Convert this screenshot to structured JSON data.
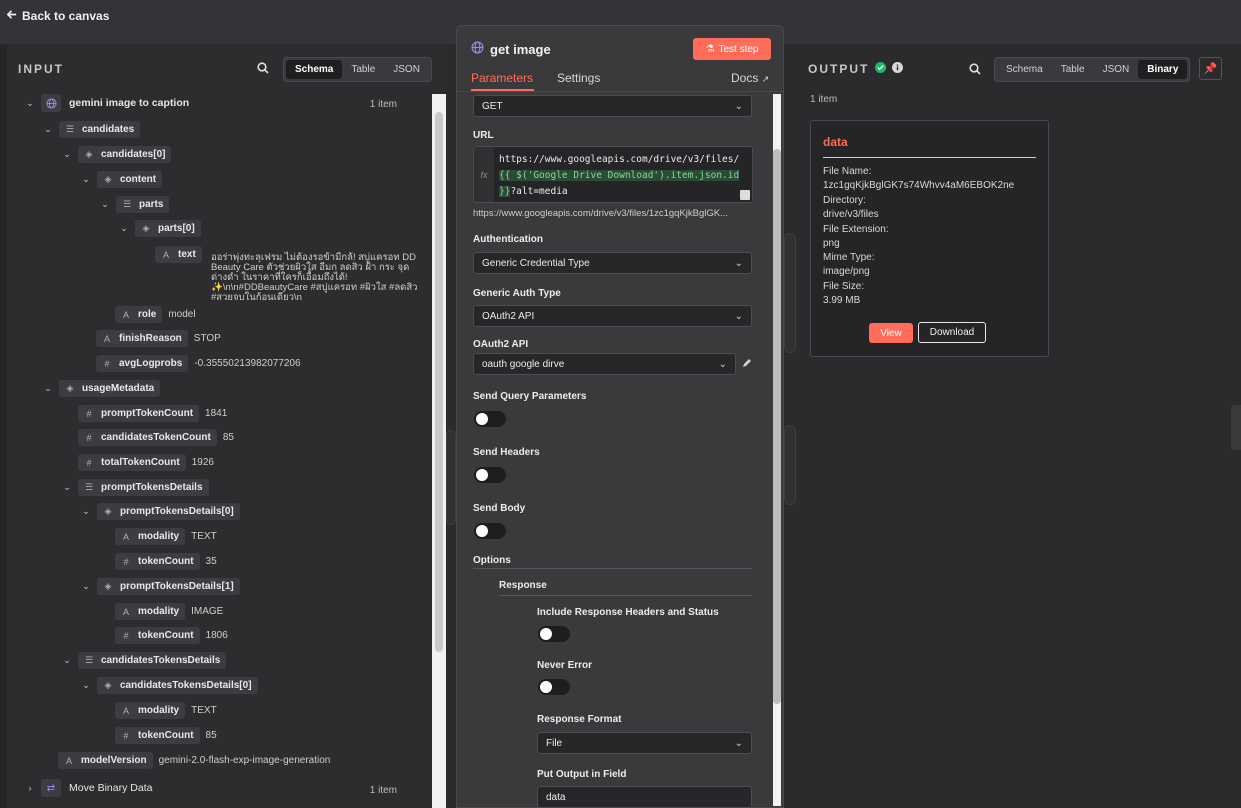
{
  "topbar": {
    "back_label": "Back to canvas"
  },
  "input": {
    "title": "INPUT",
    "tabs": [
      "Schema",
      "Table",
      "JSON"
    ],
    "active_tab": "Schema",
    "root_label": "gemini image to caption",
    "root_count": "1 item",
    "bottom_label": "Move Binary Data",
    "bottom_count": "1 item",
    "tree": {
      "candidates": "candidates",
      "candidates0": "candidates[0]",
      "content": "content",
      "parts": "parts",
      "parts0": "parts[0]",
      "text_key": "text",
      "text_value": "ออร่าพุ่งทะลุเฟรม ไม่ต้องรอข้ามีกล้! สบู่แครอท DD Beauty Care ตัวช่วยผิวใส อีมก ลดสิว ฝ้า กระ จุดด่างดำ ในราคาที่ใครก็เอื้อมถึงได้! ✨\\n\\n#DDBeautyCare #สบู่แครอท #ผิวใส #ลดสิว #สวยจบในก้อนเดียว\\n",
      "role_key": "role",
      "role_value": "model",
      "finish_key": "finishReason",
      "finish_value": "STOP",
      "avglog_key": "avgLogprobs",
      "avglog_value": "-0.35550213982077206",
      "usage": "usageMetadata",
      "prompt_count_key": "promptTokenCount",
      "prompt_count_value": "1841",
      "cand_count_key": "candidatesTokenCount",
      "cand_count_value": "85",
      "total_key": "totalTokenCount",
      "total_value": "1926",
      "ptd": "promptTokensDetails",
      "ptd0": "promptTokensDetails[0]",
      "modality_key": "modality",
      "ptd0_modality": "TEXT",
      "tokencount_key": "tokenCount",
      "ptd0_count": "35",
      "ptd1": "promptTokensDetails[1]",
      "ptd1_modality": "IMAGE",
      "ptd1_count": "1806",
      "ctd": "candidatesTokensDetails",
      "ctd0": "candidatesTokensDetails[0]",
      "ctd0_modality": "TEXT",
      "ctd0_count": "85",
      "mv_key": "modelVersion",
      "mv_value": "gemini-2.0-flash-exp-image-generation"
    }
  },
  "node": {
    "title": "get image",
    "test_label": "Test step",
    "tabs": {
      "parameters": "Parameters",
      "settings": "Settings",
      "docs": "Docs"
    },
    "method": "GET",
    "url_label": "URL",
    "url_part1": "https://www.googleapis.com/drive/v3/files/",
    "url_expr": "{{ $('Google Drive Download').item.json.id }}",
    "url_part2": "?alt=media",
    "url_preview": "https://www.googleapis.com/drive/v3/files/1zc1gqKjkBglGK...",
    "auth_label": "Authentication",
    "auth_value": "Generic Credential Type",
    "gat_label": "Generic Auth Type",
    "gat_value": "OAuth2 API",
    "oauth_label": "OAuth2 API",
    "oauth_value": "oauth google dirve",
    "sqp_label": "Send Query Parameters",
    "sh_label": "Send Headers",
    "sb_label": "Send Body",
    "options_label": "Options",
    "response_label": "Response",
    "irh_label": "Include Response Headers and Status",
    "ne_label": "Never Error",
    "rf_label": "Response Format",
    "rf_value": "File",
    "pof_label": "Put Output in Field",
    "pof_value": "data"
  },
  "output": {
    "title": "OUTPUT",
    "tabs": [
      "Schema",
      "Table",
      "JSON",
      "Binary"
    ],
    "active_tab": "Binary",
    "count": "1 item",
    "card": {
      "title": "data",
      "file_name_label": "File Name:",
      "file_name": "1zc1gqKjkBglGK7s74Whvv4aM6EBOK2ne",
      "directory_label": "Directory:",
      "directory": "drive/v3/files",
      "ext_label": "File Extension:",
      "ext": "png",
      "mime_label": "Mime Type:",
      "mime": "image/png",
      "size_label": "File Size:",
      "size": "3.99 MB",
      "view_label": "View",
      "download_label": "Download"
    }
  },
  "colors": {
    "accent": "#ff6d5a",
    "success": "#1fb868"
  }
}
